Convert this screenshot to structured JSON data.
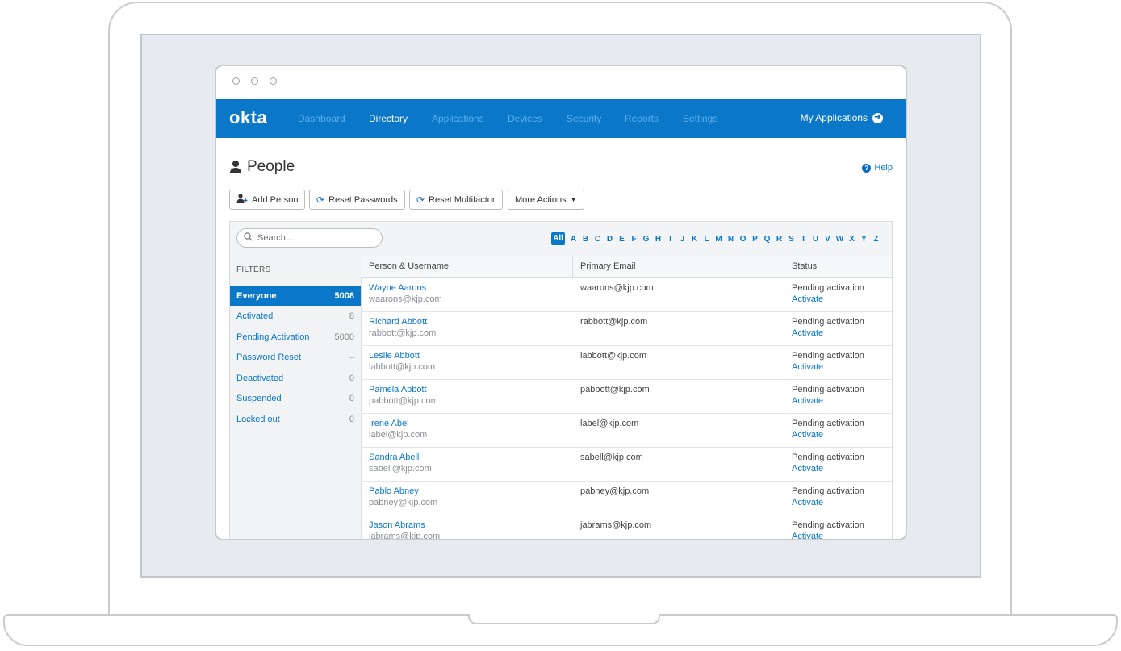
{
  "nav": {
    "logo": "okta",
    "items": [
      "Dashboard",
      "Directory",
      "Applications",
      "Devices",
      "Security",
      "Reports",
      "Settings"
    ],
    "active": "Directory",
    "my_applications": "My Applications"
  },
  "page": {
    "title": "People",
    "help": "Help"
  },
  "toolbar": {
    "add_person": "Add Person",
    "reset_passwords": "Reset Passwords",
    "reset_multifactor": "Reset Multifactor",
    "more_actions": "More Actions"
  },
  "search": {
    "placeholder": "Search..."
  },
  "alphabet": {
    "all": "All",
    "letters": [
      "A",
      "B",
      "C",
      "D",
      "E",
      "F",
      "G",
      "H",
      "I",
      "J",
      "K",
      "L",
      "M",
      "N",
      "O",
      "P",
      "Q",
      "R",
      "S",
      "T",
      "U",
      "V",
      "W",
      "X",
      "Y",
      "Z"
    ]
  },
  "filters": {
    "label": "FILTERS",
    "items": [
      {
        "label": "Everyone",
        "count": "5008",
        "active": true
      },
      {
        "label": "Activated",
        "count": "8"
      },
      {
        "label": "Pending Activation",
        "count": "5000"
      },
      {
        "label": "Password Reset",
        "count": "–"
      },
      {
        "label": "Deactivated",
        "count": "0"
      },
      {
        "label": "Suspended",
        "count": "0"
      },
      {
        "label": "Locked out",
        "count": "0"
      }
    ]
  },
  "table": {
    "columns": [
      "Person & Username",
      "Primary Email",
      "Status"
    ],
    "rows": [
      {
        "name": "Wayne Aarons",
        "username": "waarons@kjp.com",
        "email": "waarons@kjp.com",
        "status": "Pending activation",
        "action": "Activate"
      },
      {
        "name": "Richard Abbott",
        "username": "rabbott@kjp.com",
        "email": "rabbott@kjp.com",
        "status": "Pending activation",
        "action": "Activate"
      },
      {
        "name": "Leslie Abbott",
        "username": "labbott@kjp.com",
        "email": "labbott@kjp.com",
        "status": "Pending activation",
        "action": "Activate"
      },
      {
        "name": "Pamela Abbott",
        "username": "pabbott@kjp.com",
        "email": "pabbott@kjp.com",
        "status": "Pending activation",
        "action": "Activate"
      },
      {
        "name": "Irene Abel",
        "username": "label@kjp.com",
        "email": "label@kjp.com",
        "status": "Pending activation",
        "action": "Activate"
      },
      {
        "name": "Sandra Abell",
        "username": "sabell@kjp.com",
        "email": "sabell@kjp.com",
        "status": "Pending activation",
        "action": "Activate"
      },
      {
        "name": "Pablo Abney",
        "username": "pabney@kjp.com",
        "email": "pabney@kjp.com",
        "status": "Pending activation",
        "action": "Activate"
      },
      {
        "name": "Jason Abrams",
        "username": "jabrams@kjp.com",
        "email": "jabrams@kjp.com",
        "status": "Pending activation",
        "action": "Activate"
      }
    ]
  },
  "colors": {
    "brand": "#0a77c9",
    "nav_inactive": "#5ab0ee"
  }
}
